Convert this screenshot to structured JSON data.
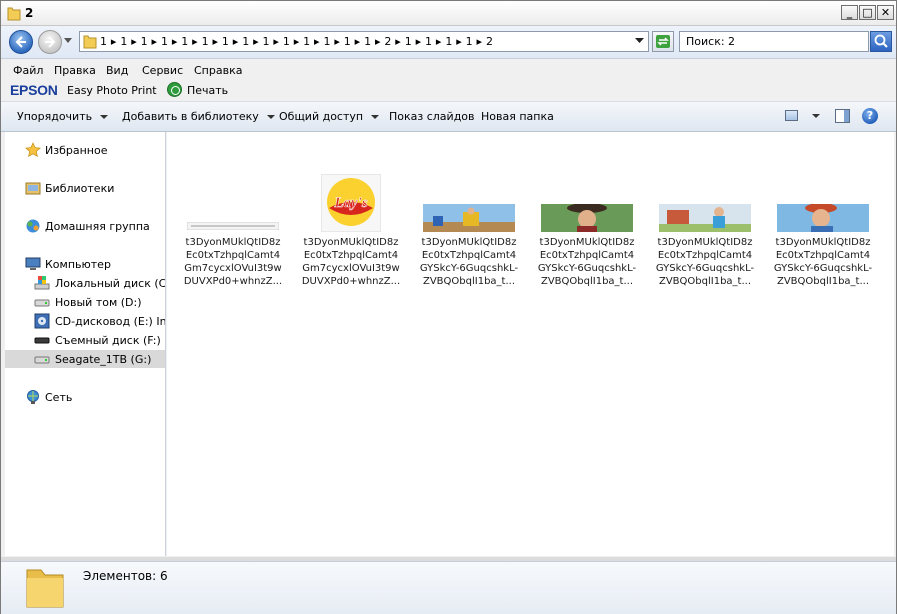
{
  "window": {
    "title": "2"
  },
  "address": {
    "crumbs": "1 ▸ 1 ▸ 1 ▸ 1 ▸ 1 ▸ 1 ▸ 1 ▸ 1 ▸ 1 ▸ 1 ▸ 1 ▸ 1 ▸ 1 ▸ 1 ▸ 2 ▸ 1 ▸ 1 ▸ 1 ▸ 1 ▸ 2",
    "search_text": "Поиск: 2"
  },
  "menu": [
    "Файл",
    "Правка",
    "Вид",
    "Сервис",
    "Справка"
  ],
  "epson": {
    "logo": "EPSON",
    "app": "Easy Photo Print",
    "print": "Печать"
  },
  "toolbar": {
    "organize": "Упорядочить",
    "add_library": "Добавить в библиотеку",
    "share": "Общий доступ",
    "slideshow": "Показ слайдов",
    "new_folder": "Новая папка"
  },
  "nav": {
    "favorites": "Избранное",
    "libraries": "Библиотеки",
    "homegroup": "Домашняя группа",
    "computer": "Компьютер",
    "drive_c": "Локальный диск (C:)",
    "drive_d": "Новый том (D:)",
    "drive_e": "CD-дисковод (E:) Inte",
    "drive_f": "Съемный диск (F:)",
    "drive_g": "Seagate_1TB (G:)",
    "network": "Сеть"
  },
  "files": [
    {
      "line1": "t3DyonMUklQtID8z",
      "line2": "Ec0txTzhpqlCamt4",
      "line3": "Gm7cycxlOVuI3t9w",
      "line4": "DUVXPd0+whnzZ..."
    },
    {
      "line1": "t3DyonMUklQtID8z",
      "line2": "Ec0txTzhpqlCamt4",
      "line3": "Gm7cycxlOVuI3t9w",
      "line4": "DUVXPd0+whnzZ..."
    },
    {
      "line1": "t3DyonMUklQtID8z",
      "line2": "Ec0txTzhpqlCamt4",
      "line3": "GYSkcY-6GuqcshkL-",
      "line4": "ZVBQObqlI1ba_t..."
    },
    {
      "line1": "t3DyonMUklQtID8z",
      "line2": "Ec0txTzhpqlCamt4",
      "line3": "GYSkcY-6GuqcshkL-",
      "line4": "ZVBQObqlI1ba_t..."
    },
    {
      "line1": "t3DyonMUklQtID8z",
      "line2": "Ec0txTzhpqlCamt4",
      "line3": "GYSkcY-6GuqcshkL-",
      "line4": "ZVBQObqlI1ba_t..."
    },
    {
      "line1": "t3DyonMUklQtID8z",
      "line2": "Ec0txTzhpqlCamt4",
      "line3": "GYSkcY-6GuqcshkL-",
      "line4": "ZVBQObqlI1ba_t..."
    }
  ],
  "lays_logo": "Lay's",
  "status": {
    "count_text": "Элементов: 6"
  },
  "colors": {
    "accent": "#2f6bc0",
    "selection": "#d9d9d9",
    "epson_blue": "#1a3e9c"
  }
}
